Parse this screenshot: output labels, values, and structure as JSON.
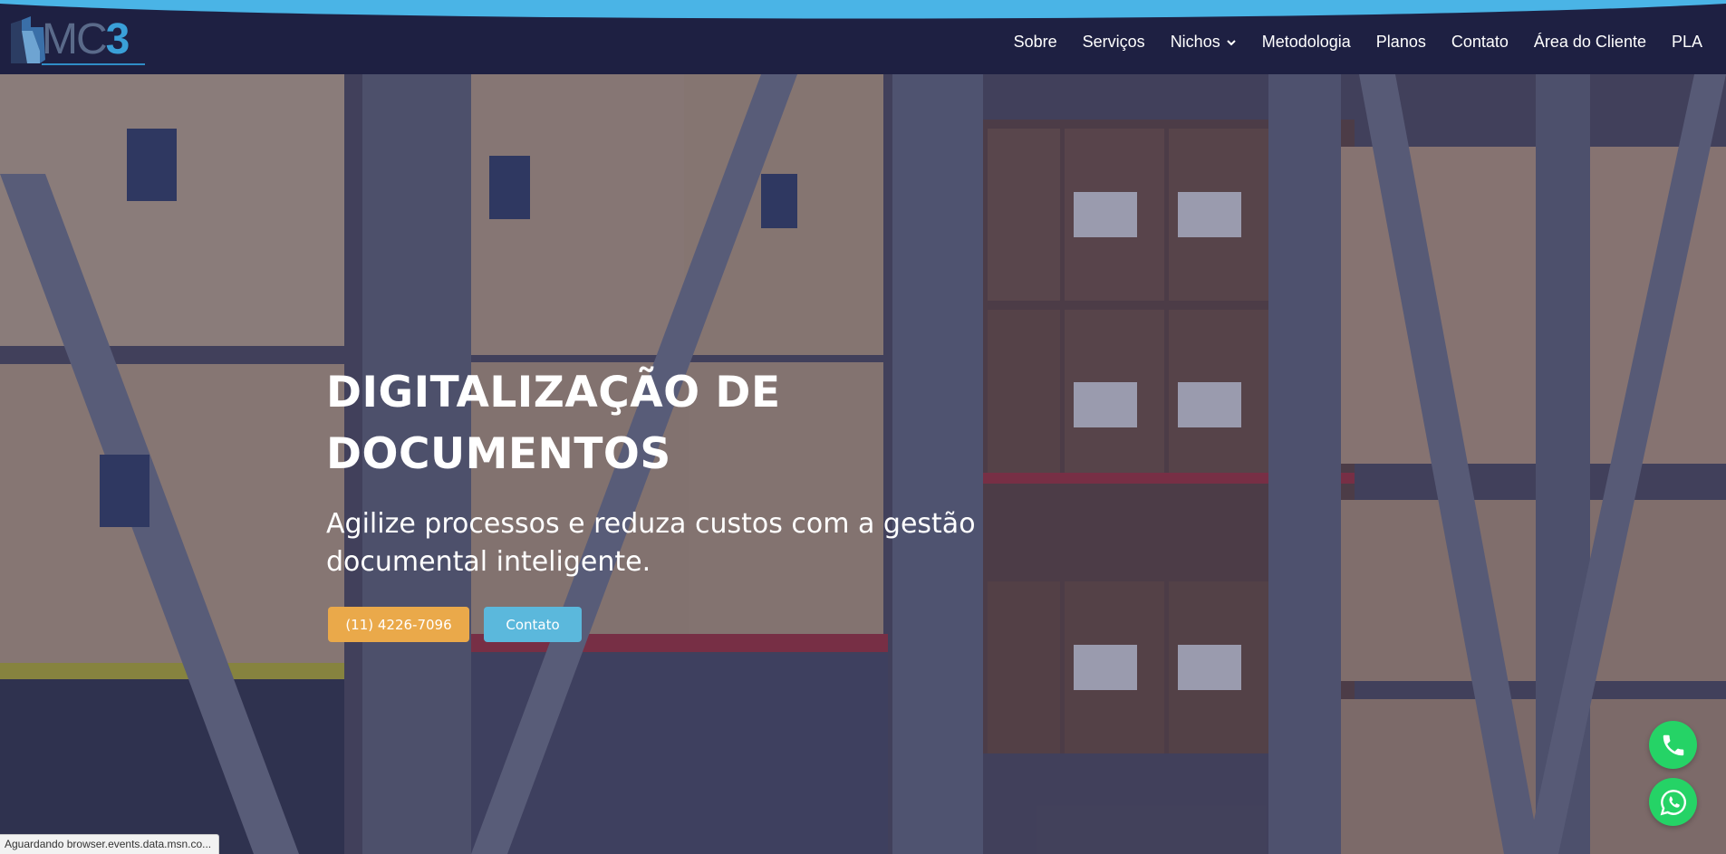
{
  "brand": {
    "logo_text": "MC",
    "logo_number": "3"
  },
  "nav": {
    "items": [
      {
        "label": "Sobre",
        "has_dropdown": false
      },
      {
        "label": "Serviços",
        "has_dropdown": false
      },
      {
        "label": "Nichos",
        "has_dropdown": true
      },
      {
        "label": "Metodologia",
        "has_dropdown": false
      },
      {
        "label": "Planos",
        "has_dropdown": false
      },
      {
        "label": "Contato",
        "has_dropdown": false
      },
      {
        "label": "Área do Cliente",
        "has_dropdown": false
      },
      {
        "label": "PLA",
        "has_dropdown": false
      }
    ]
  },
  "hero": {
    "title_line1": "DIGITALIZAÇÃO DE",
    "title_line2": "DOCUMENTOS",
    "subtitle_line1": "Agilize processos e reduza custos com a gestão",
    "subtitle_line2": "documental inteligente.",
    "phone_button": "(11) 4226-7096",
    "contact_button": "Contato"
  },
  "floating": {
    "phone_icon": "phone-icon",
    "whatsapp_icon": "whatsapp-icon"
  },
  "status_bar": {
    "text": "Aguardando browser.events.data.msn.co..."
  },
  "colors": {
    "header_bg": "#1e2042",
    "header_wave": "#4ab4e6",
    "phone_button": "#eaa94a",
    "contact_button": "#5bb8dc",
    "fab_green": "#25d366"
  }
}
